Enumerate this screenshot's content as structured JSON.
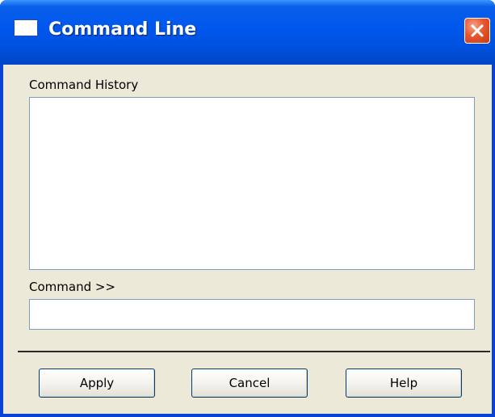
{
  "window": {
    "title": "Command Line"
  },
  "history": {
    "label": "Command History"
  },
  "command": {
    "label": "Command >>",
    "value": ""
  },
  "buttons": {
    "apply": "Apply",
    "cancel": "Cancel",
    "help": "Help"
  },
  "icons": {
    "window": "window-icon",
    "close": "close-icon"
  },
  "colors": {
    "titlebar": "#0058ee",
    "dialog_background": "#ece9d8",
    "close_button": "#e5572f"
  }
}
